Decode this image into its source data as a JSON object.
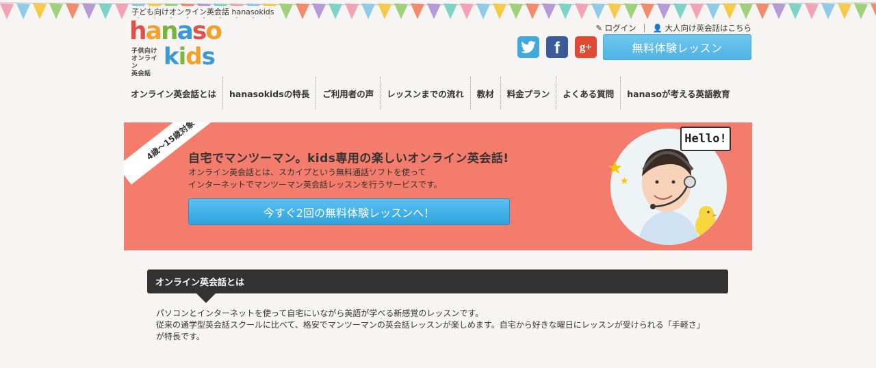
{
  "tagline": "子ども向けオンライン英会話 hanasokids",
  "logo": {
    "word_top": "hanaso",
    "word_bottom": "kids",
    "sub_lines": [
      "子供向け",
      "オンライン",
      "英会話"
    ]
  },
  "header": {
    "login_label": "ログイン",
    "separator": "|",
    "adult_label": "大人向け英会話はこちら",
    "trial_button": "無料体験レッスン",
    "social": [
      {
        "name": "twitter-icon",
        "glyph": "t"
      },
      {
        "name": "facebook-icon",
        "glyph": "f"
      },
      {
        "name": "google-plus-icon",
        "glyph": "g+"
      }
    ]
  },
  "nav": {
    "items": [
      "オンライン英会話とは",
      "hanasokidsの特長",
      "ご利用者の声",
      "レッスンまでの流れ",
      "教材",
      "料金プラン",
      "よくある質問",
      "hanasoが考える英語教育"
    ]
  },
  "hero": {
    "ribbon": "4歳〜15歳対象",
    "headline": "自宅でマンツーマン。kids専用の楽しいオンライン英会話!",
    "desc_line1": "オンライン英会話とは、スカイプという無料通話ソフトを使って",
    "desc_line2": "インターネットでマンツーマン英会話レッスンを行うサービスです。",
    "cta": "今すぐ2回の無料体験レッスンへ！",
    "bubble": "Hello!"
  },
  "section": {
    "title": "オンライン英会話とは",
    "line1": "パソコンとインターネットを使って自宅にいながら英語が学べる新感覚のレッスンです。",
    "line2": "従来の通学型英会話スクールに比べて、格安でマンツーマンの英会話レッスンが楽しめます。自宅から好きな曜日にレッスンが受けられる「手軽さ」",
    "line3": "が特長です。"
  },
  "colors": {
    "hero_bg": "#f47c6c",
    "trial_button": "#5dbceb",
    "section_bar": "#333333"
  }
}
